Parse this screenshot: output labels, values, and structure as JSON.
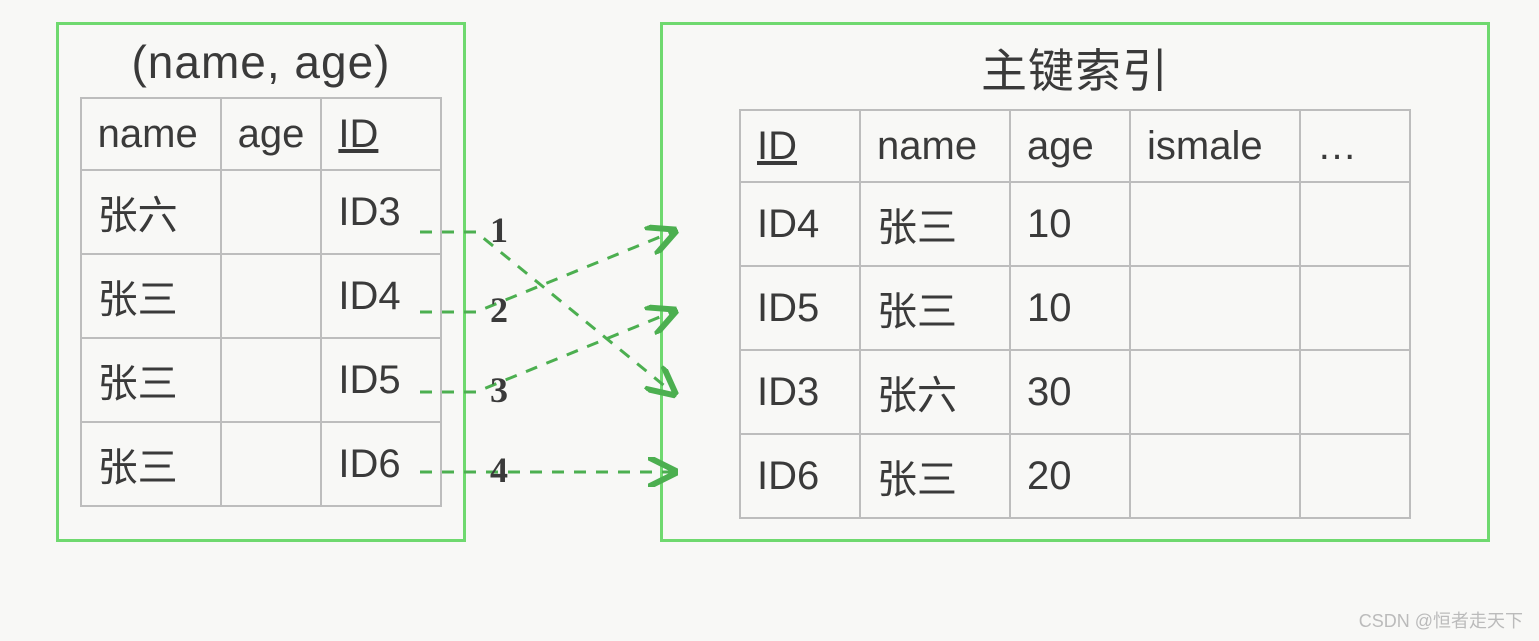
{
  "left": {
    "title": "(name, age)",
    "headers": [
      "name",
      "age",
      "ID"
    ],
    "underline": [
      false,
      false,
      true
    ],
    "rows": [
      [
        "张六",
        "",
        "ID3"
      ],
      [
        "张三",
        "",
        "ID4"
      ],
      [
        "张三",
        "",
        "ID5"
      ],
      [
        "张三",
        "",
        "ID6"
      ]
    ]
  },
  "right": {
    "title": "主键索引",
    "headers": [
      "ID",
      "name",
      "age",
      "ismale",
      "…"
    ],
    "underline": [
      true,
      false,
      false,
      false,
      false
    ],
    "rows": [
      [
        "ID4",
        "张三",
        "10",
        "",
        ""
      ],
      [
        "ID5",
        "张三",
        "10",
        "",
        ""
      ],
      [
        "ID3",
        "张六",
        "30",
        "",
        ""
      ],
      [
        "ID6",
        "张三",
        "20",
        "",
        ""
      ]
    ]
  },
  "arrows": {
    "labels": [
      "1",
      "2",
      "3",
      "4"
    ],
    "map": [
      {
        "from_row": 0,
        "to_row": 2
      },
      {
        "from_row": 1,
        "to_row": 0
      },
      {
        "from_row": 2,
        "to_row": 1
      },
      {
        "from_row": 3,
        "to_row": 3
      }
    ]
  },
  "watermark": "CSDN @恒者走天下",
  "colors": {
    "border": "#6fd96f",
    "cell": "#bdbdbd",
    "ink": "#3a3a3a",
    "arrow": "#4caf50"
  }
}
